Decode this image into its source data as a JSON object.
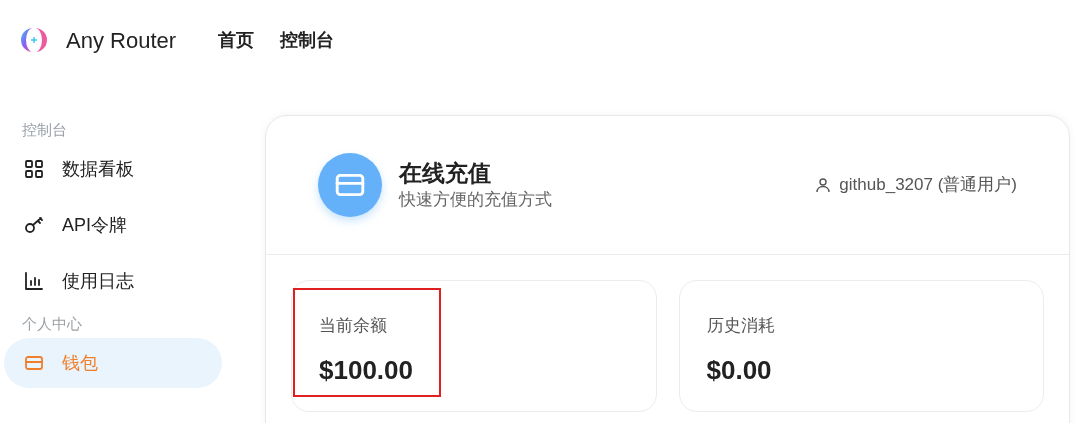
{
  "header": {
    "brand": "Any Router",
    "nav": [
      {
        "label": "首页",
        "selected": false
      },
      {
        "label": "控制台",
        "selected": false
      }
    ]
  },
  "sidebar": {
    "items": [
      {
        "kind": "section",
        "label": "控制台"
      },
      {
        "kind": "item",
        "label": "数据看板",
        "selected": false
      },
      {
        "kind": "item",
        "label": "API令牌",
        "selected": false
      },
      {
        "kind": "item",
        "label": "使用日志",
        "selected": false
      },
      {
        "kind": "section",
        "label": "个人中心"
      },
      {
        "kind": "item",
        "label": "钱包",
        "selected": true
      }
    ]
  },
  "topup": {
    "title": "在线充值",
    "subtitle": "快速方便的充值方式",
    "user": "github_3207 (普通用户)",
    "stats": [
      {
        "label": "当前余额",
        "value": "$100.00",
        "highlighted": true
      },
      {
        "label": "历史消耗",
        "value": "$0.00",
        "highlighted": false
      }
    ]
  }
}
